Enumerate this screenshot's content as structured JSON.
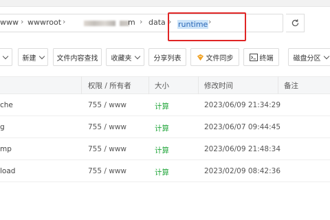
{
  "breadcrumb": {
    "items": [
      "www",
      "wwwroot",
      "m",
      "data",
      "runtime"
    ],
    "highlighted": "runtime"
  },
  "toolbar": {
    "buttons": [
      {
        "label": "新建",
        "dropdown": true
      },
      {
        "label": "文件内容查找",
        "dropdown": false
      },
      {
        "label": "收藏夹",
        "dropdown": true
      },
      {
        "label": "分享列表",
        "dropdown": false
      },
      {
        "label": "文件同步",
        "dropdown": false,
        "icon": "sync-badge-icon"
      },
      {
        "label": "终端",
        "dropdown": false,
        "icon": "terminal-icon"
      },
      {
        "label": "磁盘分区",
        "dropdown": true
      }
    ]
  },
  "table": {
    "headers": [
      "权限 / 所有者",
      "大小",
      "修改时间",
      "备注"
    ],
    "rows": [
      {
        "name": "che",
        "perm": "755 / www",
        "size": "计算",
        "mtime": "2023/06/09 21:34:29"
      },
      {
        "name": "g",
        "perm": "755 / www",
        "size": "计算",
        "mtime": "2023/06/07 09:44:45"
      },
      {
        "name": "mp",
        "perm": "755 / www",
        "size": "计算",
        "mtime": "2023/06/09 21:48:34"
      },
      {
        "name": "load",
        "perm": "755 / www",
        "size": "计算",
        "mtime": "2023/02/09 08:42:36"
      }
    ]
  },
  "colors": {
    "accent": "#20a53a",
    "highlight_box": "#e02424",
    "selection": "#cde4f9",
    "sync_icon": "#f0a020"
  }
}
